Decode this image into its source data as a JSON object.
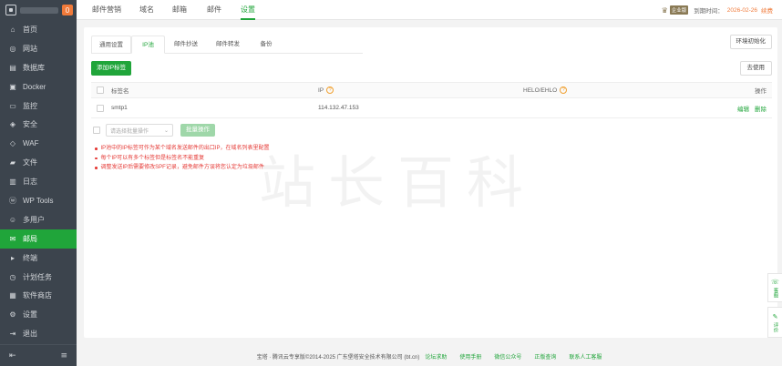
{
  "sidebar": {
    "badge": "0",
    "items": [
      {
        "label": "首页",
        "icon": "home-icon",
        "glyph": "⌂"
      },
      {
        "label": "网站",
        "icon": "globe-icon",
        "glyph": "◎"
      },
      {
        "label": "数据库",
        "icon": "database-icon",
        "glyph": "▤"
      },
      {
        "label": "Docker",
        "icon": "docker-icon",
        "glyph": "▣"
      },
      {
        "label": "监控",
        "icon": "monitor-icon",
        "glyph": "▭"
      },
      {
        "label": "安全",
        "icon": "shield-icon",
        "glyph": "◈"
      },
      {
        "label": "WAF",
        "icon": "waf-icon",
        "glyph": "◇"
      },
      {
        "label": "文件",
        "icon": "folder-icon",
        "glyph": "▰"
      },
      {
        "label": "日志",
        "icon": "log-icon",
        "glyph": "▥"
      },
      {
        "label": "WP Tools",
        "icon": "wordpress-icon",
        "glyph": "ⓦ"
      },
      {
        "label": "多用户",
        "icon": "users-icon",
        "glyph": "☺"
      },
      {
        "label": "邮局",
        "icon": "mail-icon",
        "glyph": "✉"
      },
      {
        "label": "终端",
        "icon": "terminal-icon",
        "glyph": "▸"
      },
      {
        "label": "计划任务",
        "icon": "clock-icon",
        "glyph": "◷"
      },
      {
        "label": "软件商店",
        "icon": "store-icon",
        "glyph": "▦"
      },
      {
        "label": "设置",
        "icon": "gear-icon",
        "glyph": "⚙"
      },
      {
        "label": "退出",
        "icon": "logout-icon",
        "glyph": "⇥"
      }
    ],
    "active_index": 11
  },
  "topbar": {
    "tabs": [
      "邮件营销",
      "域名",
      "邮箱",
      "邮件",
      "设置"
    ],
    "active_index": 4,
    "pro_tag": "企业版",
    "expire_label": "到期时间：",
    "expire_date": "2026-02-26",
    "renew": "续费"
  },
  "subtabs": [
    "通用设置",
    "IP池",
    "邮件抄送",
    "邮件转发",
    "备份"
  ],
  "subtab_active": 1,
  "buttons": {
    "init": "环境初始化",
    "add": "添加IP标签",
    "disabled": "去使用",
    "batch": "批量操作"
  },
  "table": {
    "headers": {
      "label": "标签名",
      "ip": "IP",
      "helo": "HELO/EHLO",
      "op": "操作"
    },
    "rows": [
      {
        "label": "smtp1",
        "ip": "114.132.47.153",
        "helo": "",
        "edit": "编辑",
        "delete": "删除"
      }
    ]
  },
  "batch_placeholder": "请选择批量操作",
  "notes": [
    "IP池中的IP标签可作为某个域名发送邮件的出口IP，在域名列表里配置",
    "每个IP可以有多个标签但是标签名不能重复",
    "调整发送IP后需要修改SPF记录，避免邮件方误将您认定为垃圾邮件"
  ],
  "watermark": "站长百科",
  "footer": {
    "copyright": "宝塔 · 腾讯云专享版©2014-2025 广东堡塔安全技术有限公司 (bt.cn)",
    "links": [
      "论坛求助",
      "使用手册",
      "微信公众号",
      "正版查询",
      "联系人工客服"
    ]
  },
  "float": {
    "service": "客服",
    "feedback": "评价"
  }
}
